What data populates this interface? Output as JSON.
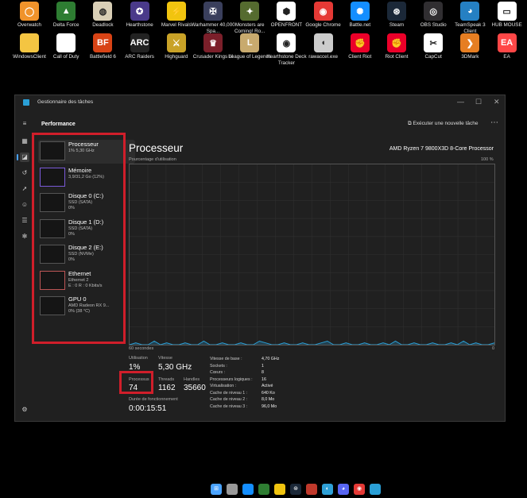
{
  "desktop": {
    "row1": [
      {
        "label": "Overwatch",
        "icon": "overwatch-icon",
        "color": "#f0932b"
      },
      {
        "label": "Delta Force",
        "icon": "delta-force-icon",
        "color": "#2e7d32"
      },
      {
        "label": "Deadlock",
        "icon": "deadlock-icon",
        "color": "#d9cfb6"
      },
      {
        "label": "Hearthstone",
        "icon": "hearthstone-icon",
        "color": "#4a3a8a"
      },
      {
        "label": "Marvel Rivals",
        "icon": "marvel-rivals-icon",
        "color": "#f1c40f"
      },
      {
        "label": "Warhammer 40,000 Spa...",
        "icon": "warhammer-icon",
        "color": "#3a3f5c"
      },
      {
        "label": "Monsters are Coming! Ro...",
        "icon": "monsters-icon",
        "color": "#556b2f"
      },
      {
        "label": "OPENFRONT",
        "icon": "openfront-icon",
        "color": "#ffffff"
      },
      {
        "label": "Google Chrome",
        "icon": "chrome-icon",
        "color": "#e53935"
      },
      {
        "label": "Battle.net",
        "icon": "battlenet-icon",
        "color": "#148eff"
      },
      {
        "label": "Steam",
        "icon": "steam-icon",
        "color": "#1b2838"
      },
      {
        "label": "OBS Studio",
        "icon": "obs-icon",
        "color": "#302e31"
      },
      {
        "label": "TeamSpeak 3 Client",
        "icon": "teamspeak-icon",
        "color": "#2580c3"
      },
      {
        "label": "HUB MOUSE",
        "icon": "hub-mouse-icon",
        "color": "#ffffff"
      }
    ],
    "row2": [
      {
        "label": "WindowsClient",
        "icon": "folder-icon",
        "color": "#f4c542"
      },
      {
        "label": "Call of Duty",
        "icon": "file-icon",
        "color": "#ffffff"
      },
      {
        "label": "Battlefield 6",
        "icon": "battlefield-icon",
        "color": "#d84315"
      },
      {
        "label": "ARC Raiders",
        "icon": "arc-raiders-icon",
        "color": "#222222"
      },
      {
        "label": "Highguard",
        "icon": "highguard-icon",
        "color": "#c9a227"
      },
      {
        "label": "Crusader Kings III",
        "icon": "crusader-kings-icon",
        "color": "#7b1f2a"
      },
      {
        "label": "League of Legends",
        "icon": "league-icon",
        "color": "#c8aa6e"
      },
      {
        "label": "Hearthstone Deck Tracker",
        "icon": "deck-tracker-icon",
        "color": "#ffffff"
      },
      {
        "label": "rawaccel.exe",
        "icon": "mouse-icon",
        "color": "#cccccc"
      },
      {
        "label": "Client Riot",
        "icon": "riot-icon",
        "color": "#eb0029"
      },
      {
        "label": "Riot Client",
        "icon": "riot-icon-2",
        "color": "#eb0029"
      },
      {
        "label": "CapCut",
        "icon": "capcut-icon",
        "color": "#ffffff"
      },
      {
        "label": "3DMark",
        "icon": "3dmark-icon",
        "color": "#e67e22"
      },
      {
        "label": "EA",
        "icon": "ea-icon",
        "color": "#ff4747"
      }
    ]
  },
  "window": {
    "title": "Gestionnaire des tâches",
    "controls": {
      "minimize": "—",
      "maximize": "☐",
      "close": "✕"
    },
    "command_bar": {
      "title": "Performance",
      "run_task": "Exécuter une nouvelle tâche",
      "more": "⋯"
    },
    "nav_icons": [
      "hamburger-icon",
      "processes-icon",
      "performance-icon",
      "app-history-icon",
      "startup-icon",
      "users-icon",
      "details-icon",
      "services-icon",
      "settings-icon"
    ],
    "resources": [
      {
        "name": "Processeur",
        "line1": "1%  5,30 GHz",
        "line2": ""
      },
      {
        "name": "Mémoire",
        "line1": "3,9/31,2 Go (12%)",
        "line2": ""
      },
      {
        "name": "Disque 0 (C:)",
        "line1": "SSD (SATA)",
        "line2": "0%"
      },
      {
        "name": "Disque 1 (D:)",
        "line1": "SSD (SATA)",
        "line2": "0%"
      },
      {
        "name": "Disque 2 (E:)",
        "line1": "SSD (NVMe)",
        "line2": "0%"
      },
      {
        "name": "Ethernet",
        "line1": "Ethernet 2",
        "line2": "E : 0 R : 0 Kbits/s"
      },
      {
        "name": "GPU 0",
        "line1": "AMD Radeon RX 9...",
        "line2": "0% (38 °C)"
      }
    ],
    "detail": {
      "title": "Processeur",
      "cpu_model": "AMD Ryzen 7 9800X3D 8-Core Processor",
      "usage_label": "Pourcentage d'utilisation",
      "max_label": "100 %",
      "time_label": "60 secondes",
      "min_label": "0",
      "stats": {
        "utilisation_label": "Utilisation",
        "utilisation": "1%",
        "vitesse_label": "Vitesse",
        "vitesse": "5,30 GHz",
        "processus_label": "Processus",
        "processus": "74",
        "threads_label": "Threads",
        "threads": "1162",
        "handles_label": "Handles",
        "handles": "35660",
        "uptime_label": "Durée de fonctionnement",
        "uptime": "0:00:15:51"
      },
      "specs": [
        {
          "label": "Vitesse de base :",
          "value": "4,70 GHz"
        },
        {
          "label": "Sockets :",
          "value": "1"
        },
        {
          "label": "Cœurs :",
          "value": "8"
        },
        {
          "label": "Processeurs logiques :",
          "value": "16"
        },
        {
          "label": "Virtualisation :",
          "value": "Activé"
        },
        {
          "label": "Cache de niveau 1 :",
          "value": "640 Ko"
        },
        {
          "label": "Cache de niveau 2 :",
          "value": "8,0 Mo"
        },
        {
          "label": "Cache de niveau 3 :",
          "value": "96,0 Mo"
        }
      ]
    }
  },
  "chart_data": {
    "type": "area",
    "title": "Processeur",
    "ylabel": "Pourcentage d'utilisation",
    "xlabel": "60 secondes",
    "ylim": [
      0,
      100
    ],
    "grid": true,
    "line_color": "#2a9fd6",
    "series": [
      {
        "values": [
          0,
          1,
          0,
          0,
          2,
          0,
          1,
          0,
          0,
          1,
          0,
          0,
          2,
          0,
          0,
          1,
          0,
          0,
          1,
          0,
          0,
          2,
          1,
          0,
          0,
          1,
          0,
          0,
          1,
          0,
          0,
          1,
          2,
          0,
          0,
          1,
          0,
          0,
          1,
          0,
          0,
          1,
          0,
          2,
          0,
          0,
          1,
          0,
          0,
          1,
          0,
          0,
          1,
          0,
          2,
          0,
          1,
          0,
          0,
          1
        ]
      }
    ]
  },
  "taskbar": {
    "items": [
      {
        "icon": "start-icon",
        "color": "#4aa3ff"
      },
      {
        "icon": "rawaccel-taskbar-icon",
        "color": "#999999"
      },
      {
        "icon": "battlenet-taskbar-icon",
        "color": "#148eff"
      },
      {
        "icon": "spotify-taskbar-icon",
        "color": "#2e7d32"
      },
      {
        "icon": "notes-taskbar-icon",
        "color": "#f1c40f"
      },
      {
        "icon": "steam-taskbar-icon",
        "color": "#1b2838"
      },
      {
        "icon": "media-taskbar-icon",
        "color": "#c0392b"
      },
      {
        "icon": "edge-taskbar-icon",
        "color": "#2ea0d6"
      },
      {
        "icon": "discord-taskbar-icon",
        "color": "#5865f2"
      },
      {
        "icon": "chrome-taskbar-icon",
        "color": "#e53935"
      },
      {
        "icon": "taskmgr-taskbar-icon",
        "color": "#2a9fd6"
      }
    ]
  }
}
